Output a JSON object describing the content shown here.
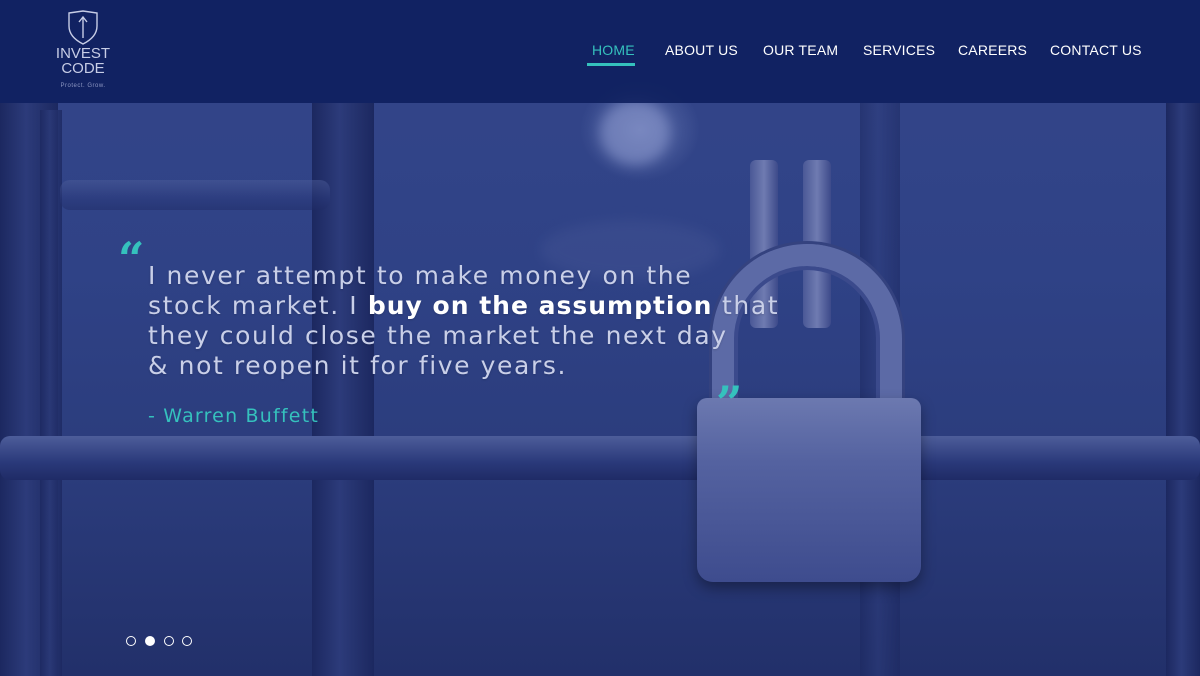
{
  "logo": {
    "brand": "INVEST\nCODE",
    "tagline": "Protect. Grow."
  },
  "nav": {
    "items": [
      {
        "label": "HOME",
        "active": true
      },
      {
        "label": "ABOUT US",
        "active": false
      },
      {
        "label": "OUR TEAM",
        "active": false
      },
      {
        "label": "SERVICES",
        "active": false
      },
      {
        "label": "CAREERS",
        "active": false
      },
      {
        "label": "CONTACT US",
        "active": false
      }
    ]
  },
  "hero": {
    "open_quote": "“",
    "close_quote": "”",
    "quote": {
      "line1": "I never attempt to make money on the",
      "line2_pre": "stock market. I ",
      "line2_bold": "buy on the assumption",
      "line2_post": " that",
      "line3": "they could close the market the next day",
      "line4": "& not reopen it for five years."
    },
    "author": "- Warren Buffett"
  },
  "slider": {
    "count": 4,
    "active_index": 1
  },
  "colors": {
    "accent": "#35c1bd",
    "navbar": "#0d1e5c",
    "overlay": "#2a3a78",
    "text": "#ffffff"
  }
}
